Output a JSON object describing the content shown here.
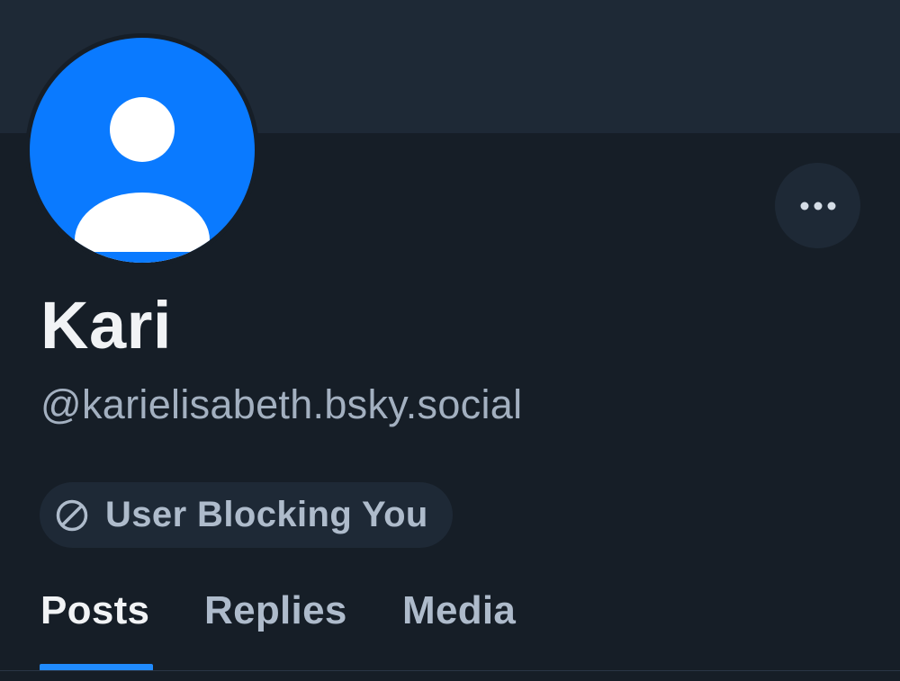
{
  "profile": {
    "display_name": "Kari",
    "handle": "@karielisabeth.bsky.social",
    "avatar_icon": "default-user-avatar-icon",
    "more_icon": "ellipsis-horizontal-icon"
  },
  "block_status": {
    "icon": "block-circle-slash-icon",
    "label": "User Blocking You"
  },
  "tabs": [
    {
      "label": "Posts",
      "selected": true
    },
    {
      "label": "Replies",
      "selected": false
    },
    {
      "label": "Media",
      "selected": false
    }
  ],
  "colors": {
    "background": "#161e27",
    "banner": "#1e2936",
    "avatar": "#0a7aff",
    "accent": "#208bfe",
    "primary_text": "#f1f3f5",
    "secondary_text": "#a3b0c0"
  }
}
